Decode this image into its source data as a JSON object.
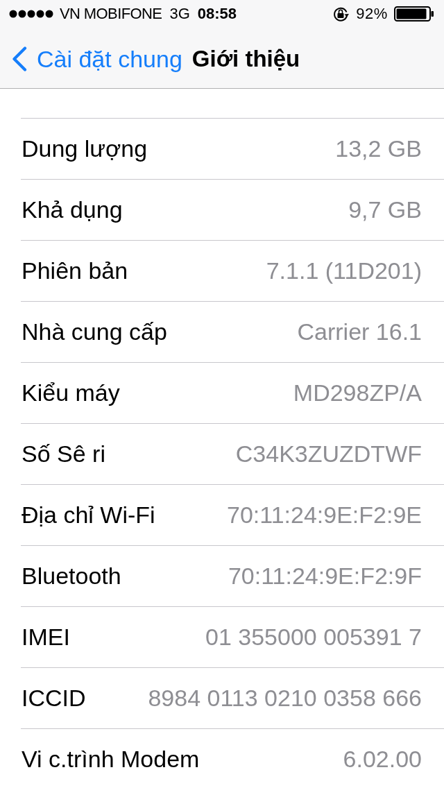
{
  "status_bar": {
    "carrier": "VN MOBIFONE",
    "network": "3G",
    "time": "08:58",
    "battery_percent": "92%"
  },
  "nav_bar": {
    "back_label": "Cài đặt chung",
    "title": "Giới thiệu"
  },
  "rows": [
    {
      "label": "Dung lượng",
      "value": "13,2 GB"
    },
    {
      "label": "Khả dụng",
      "value": "9,7 GB"
    },
    {
      "label": "Phiên bản",
      "value": "7.1.1 (11D201)"
    },
    {
      "label": "Nhà cung cấp",
      "value": "Carrier 16.1"
    },
    {
      "label": "Kiểu máy",
      "value": "MD298ZP/A"
    },
    {
      "label": "Số Sê ri",
      "value": "C34K3ZUZDTWF"
    },
    {
      "label": "Địa chỉ Wi-Fi",
      "value": "70:11:24:9E:F2:9E"
    },
    {
      "label": "Bluetooth",
      "value": "70:11:24:9E:F2:9F"
    },
    {
      "label": "IMEI",
      "value": "01 355000 005391 7"
    },
    {
      "label": "ICCID",
      "value": "8984 0113 0210 0358 666"
    },
    {
      "label": "Vi c.trình Modem",
      "value": "6.02.00"
    }
  ]
}
